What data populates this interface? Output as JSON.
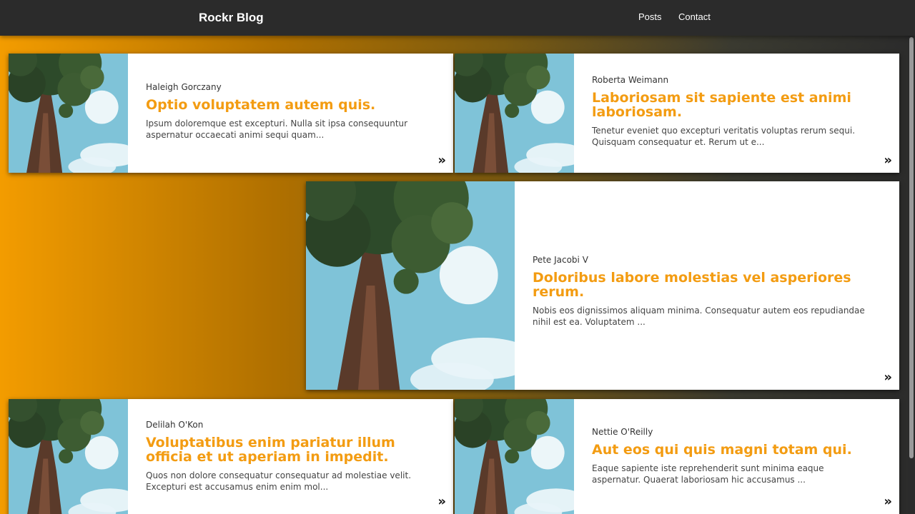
{
  "navbar": {
    "brand": "Rockr Blog",
    "links": [
      "Posts",
      "Contact"
    ]
  },
  "posts": [
    {
      "author": "Haleigh Gorczany",
      "title": "Optio voluptatem autem quis.",
      "excerpt": "Ipsum doloremque est excepturi. Nulla sit ipsa consequuntur aspernatur occaecati animi sequi quam...",
      "more_icon": "»"
    },
    {
      "author": "Roberta Weimann",
      "title": "Laboriosam sit sapiente est animi laboriosam.",
      "excerpt": "Tenetur eveniet quo excepturi veritatis voluptas rerum sequi. Quisquam consequatur et. Rerum ut e...",
      "more_icon": "»"
    },
    {
      "author": "Pete Jacobi V",
      "title": "Doloribus labore molestias vel asperiores rerum.",
      "excerpt": "Nobis eos dignissimos aliquam minima. Consequatur autem eos repudiandae nihil est ea. Voluptatem ...",
      "more_icon": "»"
    },
    {
      "author": "Delilah O'Kon",
      "title": "Voluptatibus enim pariatur illum officia et ut aperiam in impedit.",
      "excerpt": "Quos non dolore consequatur consequatur ad molestiae velit. Excepturi est accusamus enim enim mol...",
      "more_icon": "»"
    },
    {
      "author": "Nettie O'Reilly",
      "title": "Aut eos qui quis magni totam qui.",
      "excerpt": "Eaque sapiente iste reprehenderit sunt minima eaque aspernatur. Quaerat laboriosam hic accusamus ...",
      "more_icon": "»"
    }
  ],
  "colors": {
    "accent": "#f39c12",
    "navbar": "#2b2b2b",
    "gradient_start": "#f39c00",
    "gradient_end": "#2b2b2b"
  }
}
